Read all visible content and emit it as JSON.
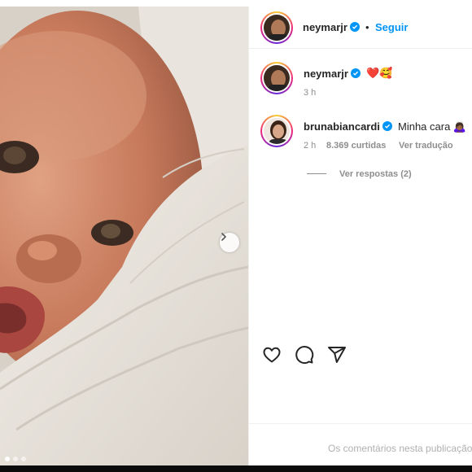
{
  "post": {
    "author": "neymarjr",
    "follow_label": "Seguir",
    "separator": "•",
    "caption_emojis": "❤️🥰",
    "caption_time": "3 h",
    "carousel": {
      "count": 3,
      "active": 1
    }
  },
  "comment": {
    "author": "brunabiancardi",
    "text": "Minha cara 🙇🏾‍♀️",
    "time": "2 h",
    "likes": "8.369 curtidas",
    "translate_label": "Ver tradução",
    "replies_label": "Ver respostas (2)"
  },
  "actions": {
    "icons": [
      "heart-icon",
      "comment-icon",
      "share-icon"
    ]
  },
  "comment_box": {
    "placeholder": "Os comentários nesta publicação"
  },
  "colors": {
    "link": "#0095f6",
    "verified": "#0095f6",
    "text": "#262626",
    "muted": "#8e8e8e"
  }
}
